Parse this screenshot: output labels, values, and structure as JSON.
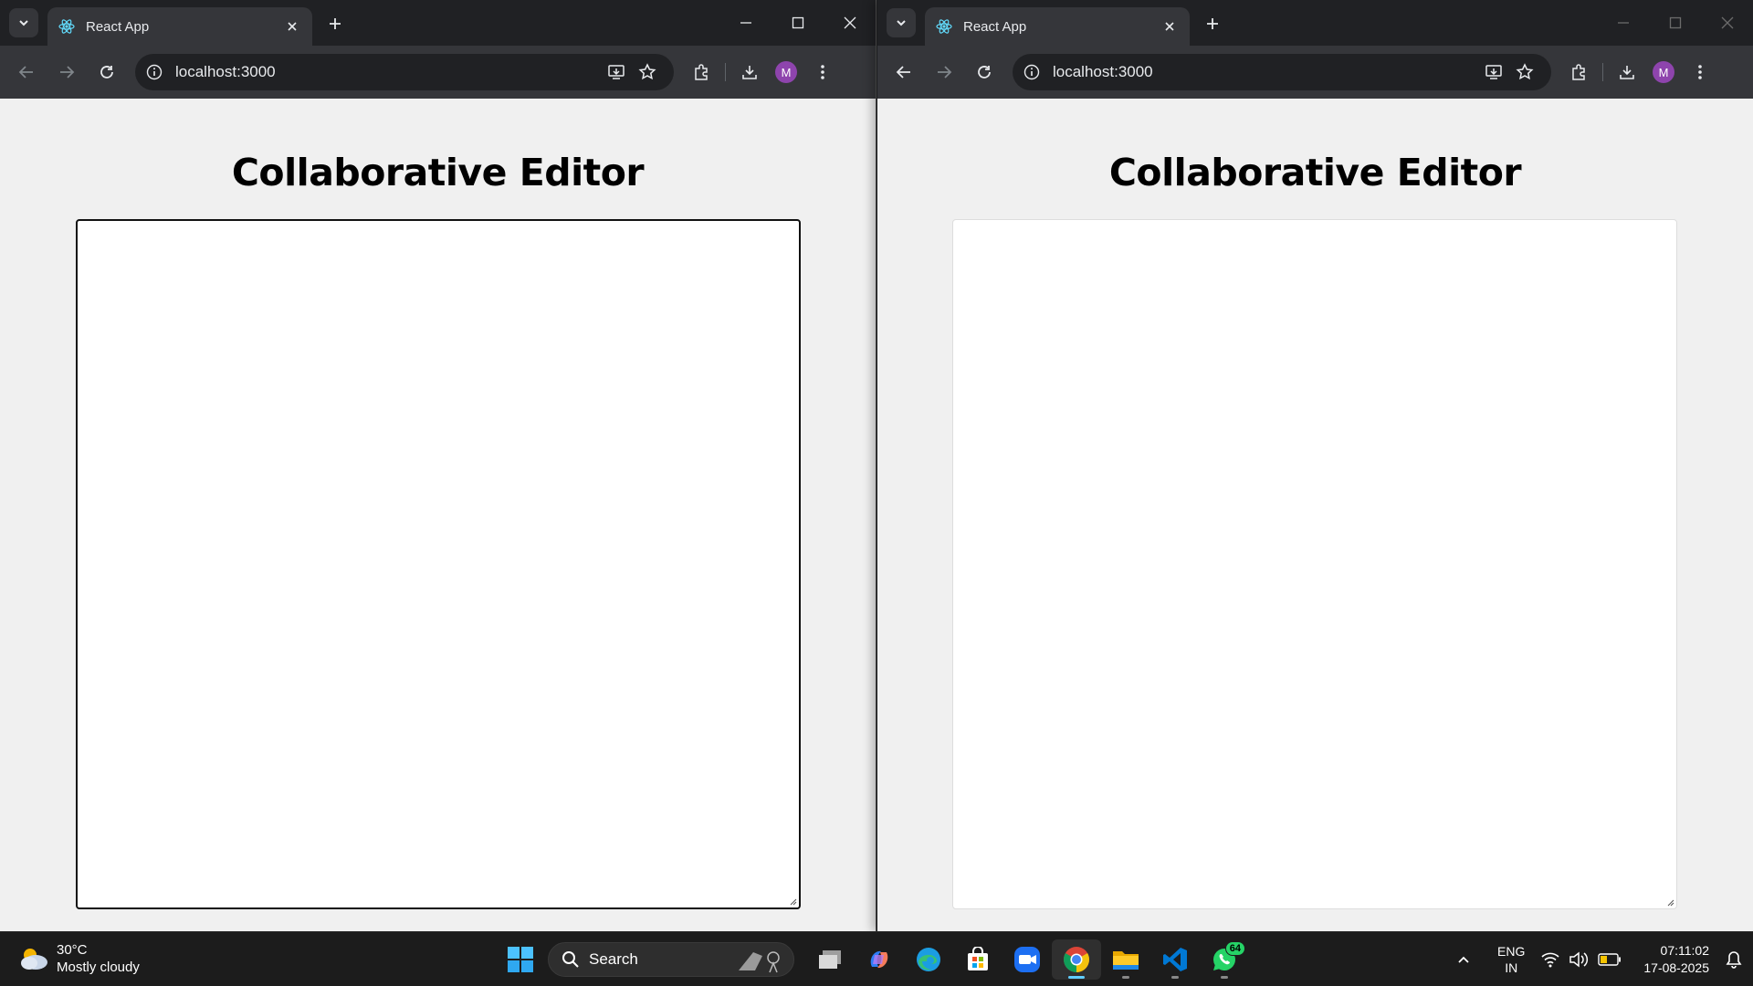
{
  "windows": [
    {
      "tab": {
        "title": "React App"
      },
      "address": "localhost:3000",
      "avatar": "M",
      "page": {
        "title": "Collaborative Editor",
        "editor_value": ""
      }
    },
    {
      "tab": {
        "title": "React App"
      },
      "address": "localhost:3000",
      "avatar": "M",
      "page": {
        "title": "Collaborative Editor",
        "editor_value": ""
      }
    }
  ],
  "taskbar": {
    "weather": {
      "temp": "30°C",
      "condition": "Mostly cloudy"
    },
    "search_label": "Search",
    "apps": [
      "task-view",
      "copilot",
      "edge",
      "microsoft-store",
      "zoom",
      "chrome",
      "file-explorer",
      "vscode",
      "whatsapp"
    ],
    "whatsapp_badge": "64",
    "language": {
      "line1": "ENG",
      "line2": "IN"
    },
    "clock": {
      "time": "07:11:02",
      "date": "17-08-2025"
    }
  },
  "colors": {
    "accent": "#8e44ad",
    "chrome_dark": "#202124",
    "chrome_toolbar": "#35363a",
    "page_bg": "#f0f0f0"
  }
}
